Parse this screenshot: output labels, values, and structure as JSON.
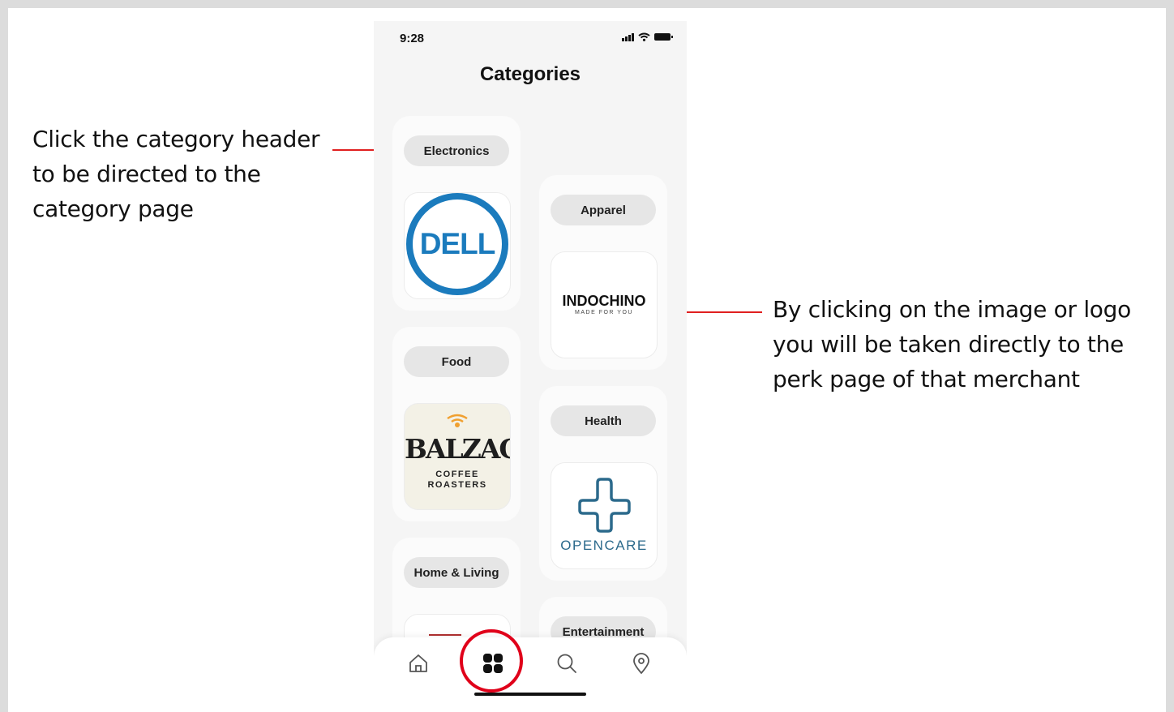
{
  "annotations": {
    "left": [
      "Click the category header",
      "to be directed to the",
      "category page"
    ],
    "right": [
      "By clicking on the image or logo",
      "you will be taken directly to the",
      "perk page of that merchant"
    ],
    "highlight_color": "#e0001a"
  },
  "status_bar": {
    "time": "9:28"
  },
  "screen": {
    "title": "Categories"
  },
  "categories": [
    {
      "label": "Electronics",
      "merchant_logo": {
        "text": "DELL"
      }
    },
    {
      "label": "Apparel",
      "merchant_logo": {
        "text": "INDOCHINO",
        "tagline": "MADE FOR YOU"
      }
    },
    {
      "label": "Food",
      "merchant_logo": {
        "text": "BALZACS",
        "tagline_1": "COFFEE",
        "tagline_2": "ROASTERS"
      }
    },
    {
      "label": "Health",
      "merchant_logo": {
        "text": "OPENCARE"
      }
    },
    {
      "label": "Home & Living"
    },
    {
      "label": "Entertainment"
    }
  ],
  "tab_bar": {
    "items": [
      "home-icon",
      "grid-icon",
      "search-icon",
      "location-pin-icon"
    ],
    "active": "grid-icon"
  },
  "colors": {
    "dell_blue": "#1b7bbd",
    "opencare_blue": "#2c6a8c",
    "balzacs_orange": "#f0a030"
  }
}
